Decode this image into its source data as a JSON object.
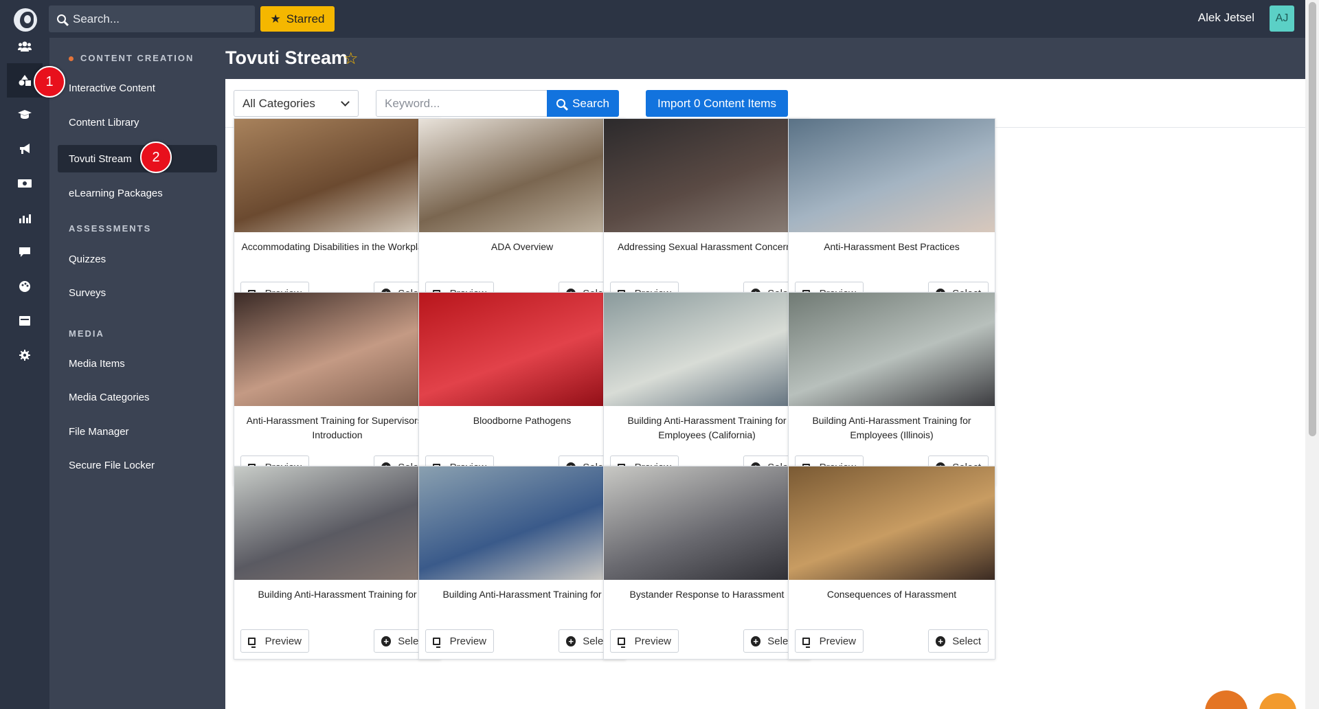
{
  "topbar": {
    "search_placeholder": "Search...",
    "starred_label": "Starred",
    "user_name": "Alek Jetsel",
    "user_initials": "AJ"
  },
  "rail": {
    "icons": [
      "users-icon",
      "shapes-icon",
      "graduation-cap-icon",
      "megaphone-icon",
      "money-icon",
      "chart-icon",
      "comment-icon",
      "palette-icon",
      "calendar-icon",
      "gear-icon"
    ]
  },
  "subnav": {
    "section_content_creation": "CONTENT CREATION",
    "item_interactive": "Interactive Content",
    "item_library": "Content Library",
    "item_stream": "Tovuti Stream",
    "item_elearning": "eLearning Packages",
    "section_assessments": "ASSESSMENTS",
    "item_quizzes": "Quizzes",
    "item_surveys": "Surveys",
    "section_media": "MEDIA",
    "item_media_items": "Media Items",
    "item_media_categories": "Media Categories",
    "item_file_manager": "File Manager",
    "item_secure_locker": "Secure File Locker"
  },
  "badges": {
    "one": "1",
    "two": "2"
  },
  "page": {
    "title": "Tovuti Stream",
    "category_selected": "All Categories",
    "keyword_placeholder": "Keyword...",
    "search_label": "Search",
    "import_label": "Import 0 Content Items"
  },
  "card_buttons": {
    "preview": "Preview",
    "select": "Select"
  },
  "cards": [
    {
      "title": "Accommodating Disabilities in the Workplace"
    },
    {
      "title": "ADA Overview"
    },
    {
      "title": "Addressing Sexual Harassment Concerns"
    },
    {
      "title": "Anti-Harassment Best Practices"
    },
    {
      "title": "Anti-Harassment Training for Supervisors - Introduction"
    },
    {
      "title": "Bloodborne Pathogens"
    },
    {
      "title": "Building Anti-Harassment Training for Employees (California)"
    },
    {
      "title": "Building Anti-Harassment Training for Employees (Illinois)"
    },
    {
      "title": "Building Anti-Harassment Training for"
    },
    {
      "title": "Building Anti-Harassment Training for"
    },
    {
      "title": "Bystander Response to Harassment"
    },
    {
      "title": "Consequences of Harassment"
    }
  ],
  "colors": {
    "topbar_bg": "#2c3444",
    "subnav_bg": "#3b4353",
    "accent_blue": "#1273de",
    "starred_yellow": "#f5b700",
    "badge_red": "#e8101c"
  }
}
